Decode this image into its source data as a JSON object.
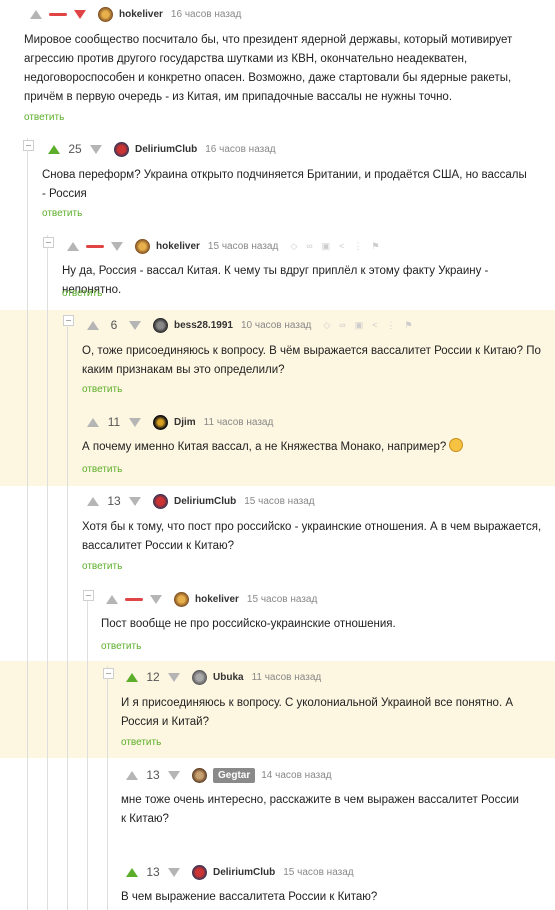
{
  "comments": [
    {
      "score": "",
      "author": "hokeliver",
      "time": "16 часов назад",
      "text": "Мировое сообщество посчитало бы, что президент ядерной державы, который мотивирует агрессию против другого государства шутками из КВН, окончательно неадекватен, недоговороспособен и конкретно опасен. Возможно, даже стартовали бы ядерные ракеты, причём в первую очередь - из Китая, им припадочные вассалы не нужны точно.",
      "reply": "ответить"
    },
    {
      "score": "25",
      "author": "DeliriumClub",
      "time": "16 часов назад",
      "text": "Снова переформ? Украина открыто подчиняется Британии, и продаётся США, но вассалы - Россия",
      "reply": "ответить"
    },
    {
      "score": "",
      "author": "hokeliver",
      "time": "15 часов назад",
      "text": "Ну да, Россия - вассал Китая. К чему ты вдруг приплёл к этому факту Украину - непонятно.",
      "reply": "ответить"
    },
    {
      "score": "6",
      "author": "bess28.1991",
      "time": "10 часов назад",
      "text": "О, тоже присоединяюсь к вопросу. В чём выражается вассалитет России к Китаю? По каким признакам вы это определили?",
      "reply": "ответить"
    },
    {
      "score": "11",
      "author": "Djim",
      "time": "11 часов назад",
      "text": "А почему именно Китая вассал, а не Княжества Монако, например?",
      "reply": "ответить"
    },
    {
      "score": "13",
      "author": "DeliriumClub",
      "time": "15 часов назад",
      "text": "Хотя бы к тому, что пост про российско - украинские отношения. А в чем выражается, вассалитет России к Китаю?",
      "reply": "ответить"
    },
    {
      "score": "",
      "author": "hokeliver",
      "time": "15 часов назад",
      "text": "Пост вообще не про российско-украинские отношения.",
      "reply": "ответить"
    },
    {
      "score": "12",
      "author": "Ubuka",
      "time": "11 часов назад",
      "text": "И я присоединяюсь к вопросу. С уколониальной Украиной все понятно. А Россия и Китай?",
      "reply": "ответить"
    },
    {
      "score": "13",
      "author": "Gegtar",
      "time": "14 часов назад",
      "text": "мне тоже очень интересно, расскажите в чем выражен вассалитет России к Китаю?",
      "reply": ""
    },
    {
      "score": "13",
      "author": "DeliriumClub",
      "time": "15 часов назад",
      "text": "В чем выражение вассалитета России к Китаю?",
      "reply": ""
    }
  ],
  "icons": [
    "arrow-up-icon",
    "arrow-down-icon",
    "collapse-icon",
    "emoji-thinking-icon"
  ]
}
